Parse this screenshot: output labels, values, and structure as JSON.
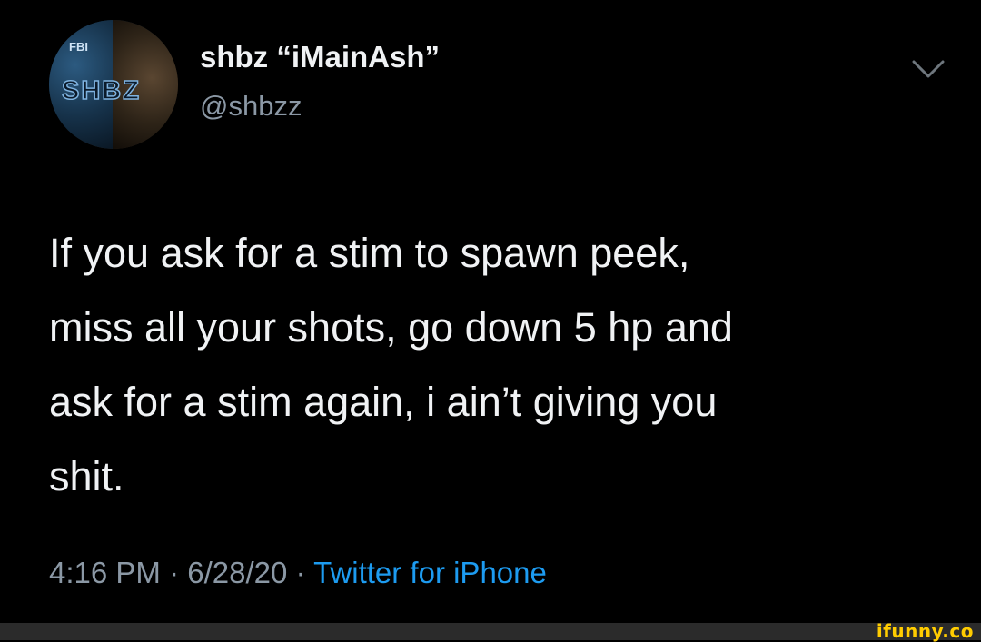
{
  "tweet": {
    "author": {
      "display_name": "shbz “iMainAsh”",
      "handle": "@shbzz",
      "avatar": {
        "badge_text": "FBI",
        "logo_text": "SHBZ"
      }
    },
    "text_lines": [
      "If you ask for a stim to spawn peek,",
      "miss all your shots, go down 5 hp and",
      "ask for a stim again, i ain’t giving you",
      "shit."
    ],
    "time": "4:16 PM",
    "date": "6/28/20",
    "separator": " · ",
    "source": "Twitter for iPhone",
    "menu_icon": "chevron-down-icon"
  },
  "watermark": "ifunny.co",
  "colors": {
    "background": "#000000",
    "text": "#f0f2f4",
    "muted": "#8b98a5",
    "link": "#1d9bf0",
    "watermark": "#ffcc00"
  }
}
